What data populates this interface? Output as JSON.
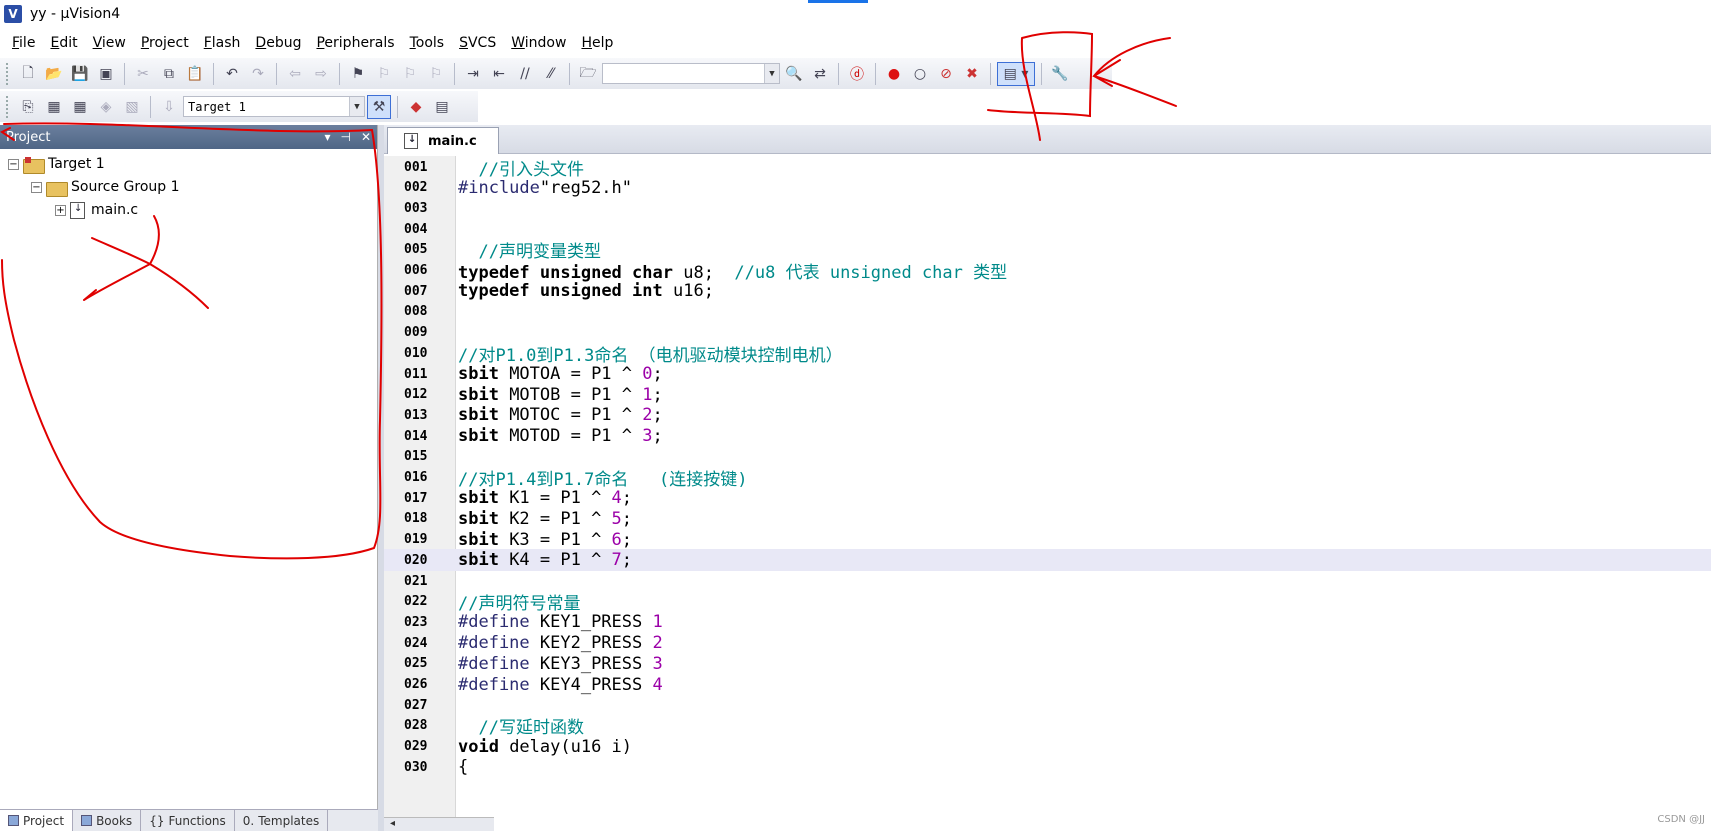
{
  "window": {
    "title": "yy  - µVision4",
    "icon": "uv-app-icon"
  },
  "menu": {
    "items": [
      {
        "label": "File"
      },
      {
        "label": "Edit"
      },
      {
        "label": "View"
      },
      {
        "label": "Project"
      },
      {
        "label": "Flash"
      },
      {
        "label": "Debug"
      },
      {
        "label": "Peripherals"
      },
      {
        "label": "Tools"
      },
      {
        "label": "SVCS"
      },
      {
        "label": "Window"
      },
      {
        "label": "Help"
      }
    ]
  },
  "toolbar2": {
    "target_select": "Target 1"
  },
  "project_panel": {
    "title": "Project",
    "tree": [
      {
        "label": "Target 1"
      },
      {
        "label": "Source Group 1"
      },
      {
        "label": "main.c"
      }
    ],
    "tabs": [
      {
        "label": "Project"
      },
      {
        "label": "Books"
      },
      {
        "label": "Functions"
      },
      {
        "label": "Templates"
      }
    ]
  },
  "editor": {
    "active_tab": "main.c",
    "current_line": "020",
    "lines": [
      {
        "n": "001",
        "t": "  //引入头文件"
      },
      {
        "n": "002",
        "t": "#include\"reg52.h\""
      },
      {
        "n": "003",
        "t": ""
      },
      {
        "n": "004",
        "t": ""
      },
      {
        "n": "005",
        "t": "  //声明变量类型"
      },
      {
        "n": "006",
        "t": "typedef unsigned char u8;  //u8 代表 unsigned char 类型"
      },
      {
        "n": "007",
        "t": "typedef unsigned int u16;"
      },
      {
        "n": "008",
        "t": ""
      },
      {
        "n": "009",
        "t": ""
      },
      {
        "n": "010",
        "t": "//对P1.0到P1.3命名 （电机驱动模块控制电机）"
      },
      {
        "n": "011",
        "t": "sbit MOTOA = P1 ^ 0;"
      },
      {
        "n": "012",
        "t": "sbit MOTOB = P1 ^ 1;"
      },
      {
        "n": "013",
        "t": "sbit MOTOC = P1 ^ 2;"
      },
      {
        "n": "014",
        "t": "sbit MOTOD = P1 ^ 3;"
      },
      {
        "n": "015",
        "t": ""
      },
      {
        "n": "016",
        "t": "//对P1.4到P1.7命名   (连接按键)"
      },
      {
        "n": "017",
        "t": "sbit K1 = P1 ^ 4;"
      },
      {
        "n": "018",
        "t": "sbit K2 = P1 ^ 5;"
      },
      {
        "n": "019",
        "t": "sbit K3 = P1 ^ 6;"
      },
      {
        "n": "020",
        "t": "sbit K4 = P1 ^ 7;"
      },
      {
        "n": "021",
        "t": ""
      },
      {
        "n": "022",
        "t": "//声明符号常量"
      },
      {
        "n": "023",
        "t": "#define KEY1_PRESS 1"
      },
      {
        "n": "024",
        "t": "#define KEY2_PRESS 2"
      },
      {
        "n": "025",
        "t": "#define KEY3_PRESS 3"
      },
      {
        "n": "026",
        "t": "#define KEY4_PRESS 4"
      },
      {
        "n": "027",
        "t": ""
      },
      {
        "n": "028",
        "t": "  //写延时函数"
      },
      {
        "n": "029",
        "t": "void delay(u16 i)"
      },
      {
        "n": "030",
        "t": "{"
      }
    ]
  },
  "watermark": "CSDN @JJ",
  "colors": {
    "comment": "#008a8a",
    "number": "#9b00a8",
    "current_line_bg": "#e8e8f6",
    "annotation": "#e00000"
  }
}
